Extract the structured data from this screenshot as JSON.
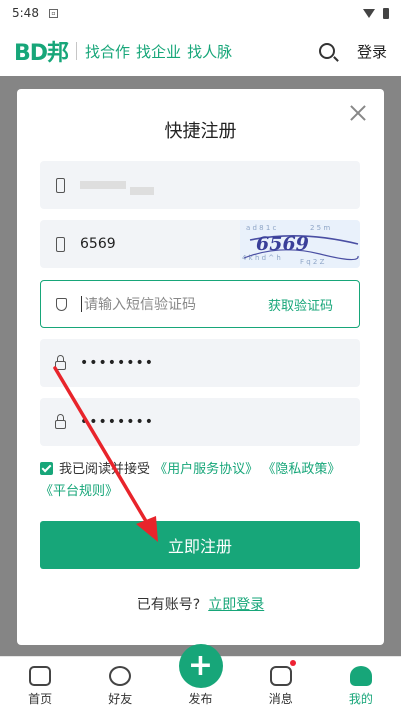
{
  "status_bar": {
    "time": "5:48"
  },
  "header": {
    "logo": "BD邦",
    "nav": [
      "找合作",
      "找企业",
      "找人脉"
    ],
    "login": "登录"
  },
  "modal": {
    "title": "快捷注册",
    "phone_dots": "",
    "captcha_value": "6569",
    "captcha_text": "6569",
    "sms_placeholder": "请输入短信验证码",
    "get_code": "获取验证码",
    "password": "••••••••",
    "password_confirm": "••••••••",
    "agree_prefix": "我已阅读并接受",
    "agree_links": [
      "《用户服务协议》",
      "《隐私政策》",
      "《平台规则》"
    ],
    "submit": "立即注册",
    "have_account": "已有账号?",
    "login_now": "立即登录"
  },
  "tabs": [
    {
      "label": "首页"
    },
    {
      "label": "好友"
    },
    {
      "label": "发布"
    },
    {
      "label": "消息"
    },
    {
      "label": "我的"
    }
  ],
  "colors": {
    "accent": "#17a679",
    "arrow": "#e8242b"
  }
}
